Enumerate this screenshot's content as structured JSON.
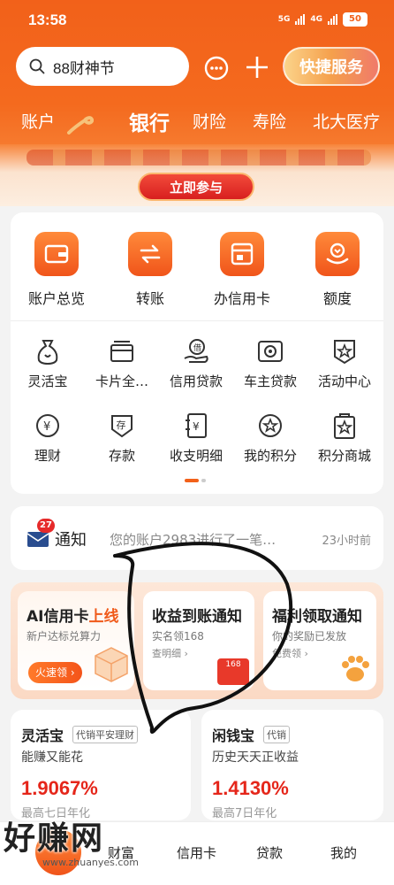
{
  "status_bar": {
    "time": "13:58",
    "network1": "5G",
    "network2": "4G",
    "battery": "50"
  },
  "search": {
    "placeholder": "88财神节"
  },
  "header": {
    "quick_service": "快捷服务"
  },
  "tabs": [
    {
      "label": "账户"
    },
    {
      "label": "银行"
    },
    {
      "label": "财险"
    },
    {
      "label": "寿险"
    },
    {
      "label": "北大医疗"
    }
  ],
  "banner": {
    "join_label": "立即参与"
  },
  "main_actions": [
    {
      "label": "账户总览",
      "icon": "wallet-icon"
    },
    {
      "label": "转账",
      "icon": "transfer-icon"
    },
    {
      "label": "办信用卡",
      "icon": "credit-card-icon"
    },
    {
      "label": "额度",
      "icon": "quota-icon"
    }
  ],
  "services_row1": [
    {
      "label": "灵活宝",
      "icon": "money-bag-icon"
    },
    {
      "label": "卡片全…",
      "icon": "card-stack-icon"
    },
    {
      "label": "信用贷款",
      "icon": "loan-hand-icon"
    },
    {
      "label": "车主贷款",
      "icon": "car-icon"
    },
    {
      "label": "活动中心",
      "icon": "star-badge-icon"
    }
  ],
  "services_row2": [
    {
      "label": "理财",
      "icon": "yuan-circle-icon"
    },
    {
      "label": "存款",
      "icon": "deposit-shield-icon"
    },
    {
      "label": "收支明细",
      "icon": "ledger-icon"
    },
    {
      "label": "我的积分",
      "icon": "star-circle-icon"
    },
    {
      "label": "积分商城",
      "icon": "star-bag-icon"
    }
  ],
  "notice": {
    "badge": "27",
    "title": "通知",
    "text": "您的账户2983进行了一笔…",
    "time": "23小时前"
  },
  "promos": [
    {
      "title": "AI信用卡",
      "title_hl": "上线",
      "sub": "新户达标兑算力",
      "button": "火速领 ›"
    },
    {
      "title": "收益到账通知",
      "sub": "实名领168",
      "link": "查明细 ›",
      "prize": "168"
    },
    {
      "title": "福利领取通知",
      "sub": "你的奖励已发放",
      "link": "免费领 ›"
    }
  ],
  "funds": [
    {
      "name": "灵活宝",
      "tag": "代销平安理财",
      "desc": "能赚又能花",
      "rate": "1.9067%",
      "note": "最高七日年化"
    },
    {
      "name": "闲钱宝",
      "tag": "代销",
      "desc": "历史天天正收益",
      "rate": "1.4130%",
      "note": "最高7日年化"
    }
  ],
  "bottom_nav": [
    {
      "label": "财富"
    },
    {
      "label": "信用卡"
    },
    {
      "label": "贷款"
    },
    {
      "label": "我的"
    }
  ],
  "watermark": {
    "text": "好赚网",
    "sub": "www.zhuanyes.com"
  },
  "colors": {
    "brand": "#f2611a",
    "rate_red": "#e5261a",
    "badge_red": "#e62a2a"
  }
}
